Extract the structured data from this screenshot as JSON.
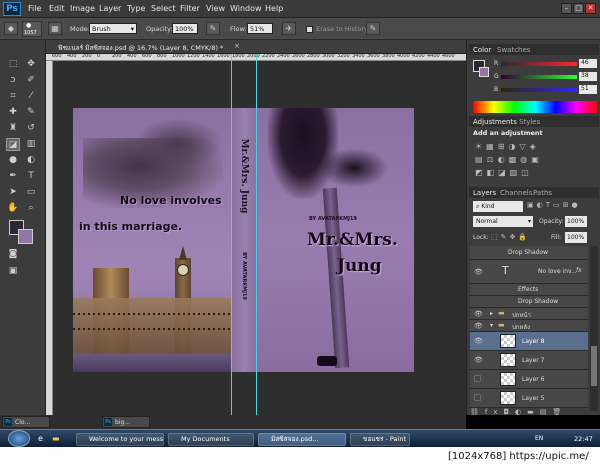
{
  "app": {
    "logo": "Ps"
  },
  "menu": [
    "File",
    "Edit",
    "Image",
    "Layer",
    "Type",
    "Select",
    "Filter",
    "View",
    "Window",
    "Help"
  ],
  "window_controls": [
    "–",
    "□",
    "✕"
  ],
  "options": {
    "brush_size": "1057",
    "mode_label": "Mode:",
    "mode_value": "Brush",
    "opacity_label": "Opacity:",
    "opacity_value": "100%",
    "flow_label": "Flow:",
    "flow_value": "51%",
    "erase_history": "Erase to History"
  },
  "document": {
    "tab_title": "ฟิชแนลร์ มิสซิสจอง.psd @ 16.7% (Layer 8, CMYK/8) *",
    "ruler_numbers": [
      "600",
      "400",
      "200",
      "0",
      "200",
      "400",
      "600",
      "800",
      "1000",
      "1200",
      "1400",
      "1600",
      "1800",
      "2000",
      "2200",
      "2400",
      "2600",
      "2800",
      "3000",
      "3200",
      "3400",
      "3600",
      "3800",
      "4000",
      "4200",
      "4400",
      "4600"
    ]
  },
  "canvas": {
    "front_tagline_1": "No love involves",
    "front_tagline_2": "in this marriage.",
    "spine_title": "Mr.&Mrs. Jung",
    "spine_author": "BY AVATARKMJ19",
    "back_author": "BY AVATARKMJ19",
    "back_title_1": "Mr.&Mrs.",
    "back_title_2": "Jung"
  },
  "color_panel": {
    "tabs": [
      "Color",
      "Swatches"
    ],
    "r_label": "R",
    "r_value": "46",
    "g_label": "G",
    "g_value": "38",
    "b_label": "B",
    "b_value": "51"
  },
  "adjustments_panel": {
    "tabs": [
      "Adjustments",
      "Styles"
    ],
    "heading": "Add an adjustment"
  },
  "layers_panel": {
    "tabs": [
      "Layers",
      "Channels",
      "Paths"
    ],
    "kind": "Kind",
    "blend_mode": "Normal",
    "opacity_label": "Opacity:",
    "opacity_value": "100%",
    "lock_label": "Lock:",
    "fill_label": "Fill:",
    "fill_value": "100%",
    "rows": [
      {
        "name": "Drop Shadow"
      },
      {
        "name": "No love inv..."
      },
      {
        "name": "Effects"
      },
      {
        "name": "Drop Shadow"
      },
      {
        "name": "ปกหน้า"
      },
      {
        "name": "ปกหลัง"
      },
      {
        "name": "Layer 8"
      },
      {
        "name": "Layer 7"
      },
      {
        "name": "Layer 6"
      },
      {
        "name": "Layer 5"
      }
    ],
    "fx": "fx"
  },
  "minimized": [
    {
      "label": "Clo..."
    },
    {
      "label": "big..."
    }
  ],
  "taskbar": {
    "items": [
      {
        "label": "Welcome to your mess..."
      },
      {
        "label": "My Documents"
      },
      {
        "label": "มิสซิสจอง.psd..."
      },
      {
        "label": "ขอแชร - Paint"
      }
    ],
    "lang": "EN",
    "time": "22:47"
  },
  "watermark": "[1024x768] https://upic.me/"
}
